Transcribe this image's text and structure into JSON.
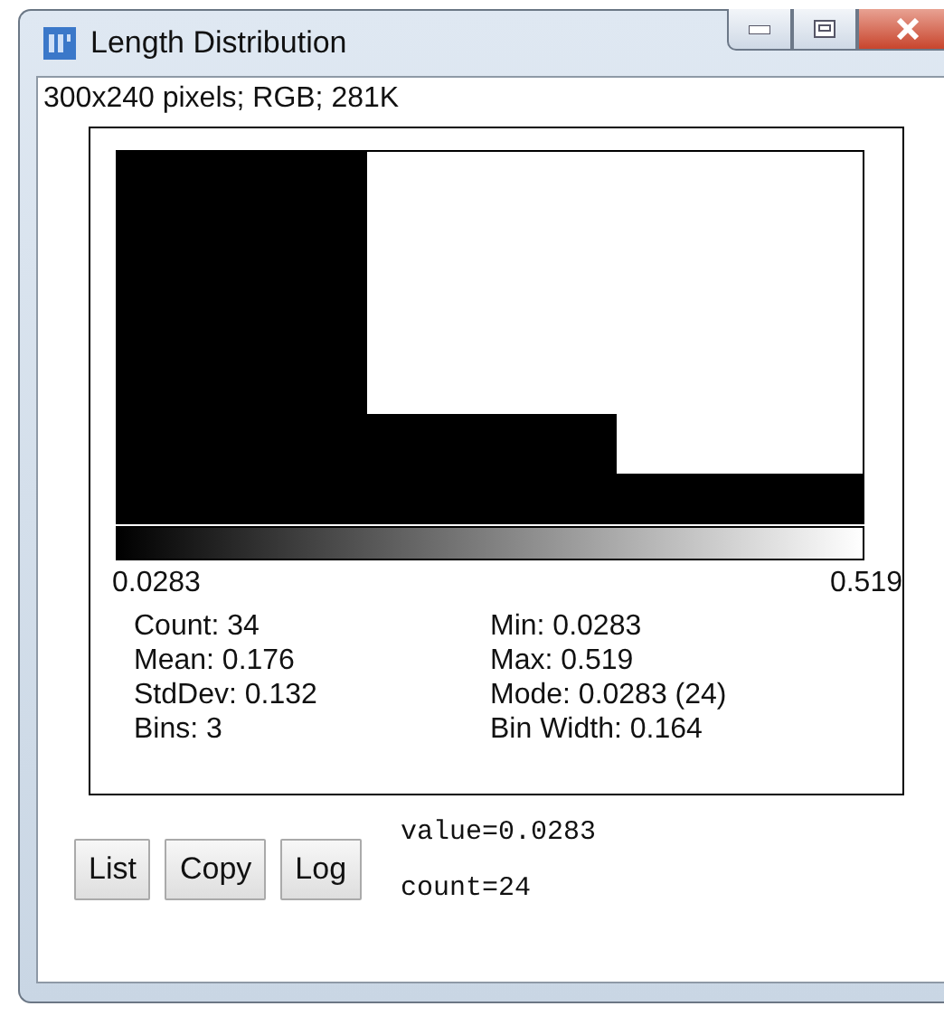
{
  "window": {
    "title": "Length Distribution"
  },
  "image_info": "300x240 pixels; RGB; 281K",
  "axis": {
    "min_label": "0.0283",
    "max_label": "0.519"
  },
  "stats_left": [
    "Count: 34",
    "Mean: 0.176",
    "StdDev: 0.132",
    "Bins: 3"
  ],
  "stats_right": [
    "Min: 0.0283",
    "Max: 0.519",
    "Mode: 0.0283 (24)",
    "Bin Width: 0.164"
  ],
  "buttons": [
    "List",
    "Copy",
    "Log"
  ],
  "readout": [
    "value=0.0283",
    "count=24"
  ]
}
